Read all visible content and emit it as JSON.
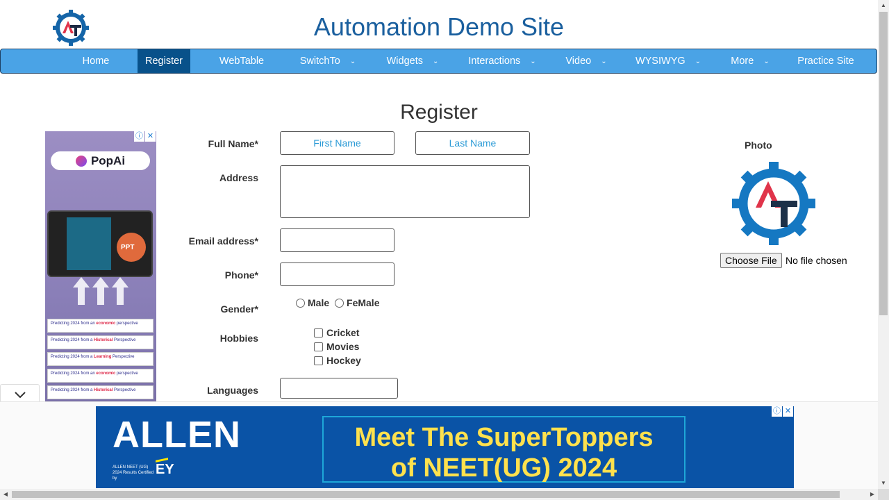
{
  "header": {
    "site_title": "Automation Demo Site",
    "logo_icon": "at-gear-logo-icon"
  },
  "nav": {
    "items": [
      {
        "label": "Home",
        "dropdown": false,
        "active": false
      },
      {
        "label": "Register",
        "dropdown": false,
        "active": true
      },
      {
        "label": "WebTable",
        "dropdown": false,
        "active": false
      },
      {
        "label": "SwitchTo",
        "dropdown": true,
        "active": false
      },
      {
        "label": "Widgets",
        "dropdown": true,
        "active": false
      },
      {
        "label": "Interactions",
        "dropdown": true,
        "active": false
      },
      {
        "label": "Video",
        "dropdown": true,
        "active": false
      },
      {
        "label": "WYSIWYG",
        "dropdown": true,
        "active": false
      },
      {
        "label": "More",
        "dropdown": true,
        "active": false
      },
      {
        "label": "Practice Site",
        "dropdown": false,
        "active": false
      }
    ],
    "chevron_glyph": "⌄"
  },
  "form": {
    "heading": "Register",
    "full_name_label": "Full Name*",
    "first_name_placeholder": "First Name",
    "last_name_placeholder": "Last Name",
    "address_label": "Address",
    "address_value": "",
    "email_label": "Email address*",
    "email_value": "",
    "phone_label": "Phone*",
    "phone_value": "",
    "gender_label": "Gender*",
    "gender_options": [
      "Male",
      "FeMale"
    ],
    "hobbies_label": "Hobbies",
    "hobbies_options": [
      "Cricket",
      "Movies",
      "Hockey"
    ],
    "languages_label": "Languages",
    "languages_value": ""
  },
  "photo": {
    "label": "Photo",
    "choose_file_label": "Choose File",
    "file_status": "No file chosen"
  },
  "ads": {
    "left": {
      "brand": "PopAi",
      "ppt_label": "PPT",
      "strips": [
        {
          "prefix": "Predicting 2024 from an ",
          "highlight": "economic",
          "suffix": " perspective"
        },
        {
          "prefix": "Predicting 2024 from a ",
          "highlight": "Historical",
          "suffix": " Perspective"
        },
        {
          "prefix": "Predicting 2024 from a ",
          "highlight": "Learning",
          "suffix": " Perspective"
        },
        {
          "prefix": "Predicting 2024 from an ",
          "highlight": "economic",
          "suffix": " perspective"
        },
        {
          "prefix": "Predicting 2024 from a ",
          "highlight": "Historical",
          "suffix": " Perspective"
        }
      ]
    },
    "bottom": {
      "brand": "ALLEN",
      "sub_text": "ALLEN NEET (UG) 2024 Results Certified by",
      "partner": "EY",
      "headline_line1": "Meet The SuperToppers",
      "headline_line2": "of NEET(UG) 2024"
    },
    "info_glyph": "ⓘ",
    "close_glyph": "✕"
  },
  "colors": {
    "nav_bg": "#4aa3e6",
    "nav_active": "#08518a",
    "title": "#1a5f9e",
    "placeholder": "#2a9ad6",
    "allen_blue": "#0a53a6",
    "headline_yellow": "#ffe14d"
  }
}
